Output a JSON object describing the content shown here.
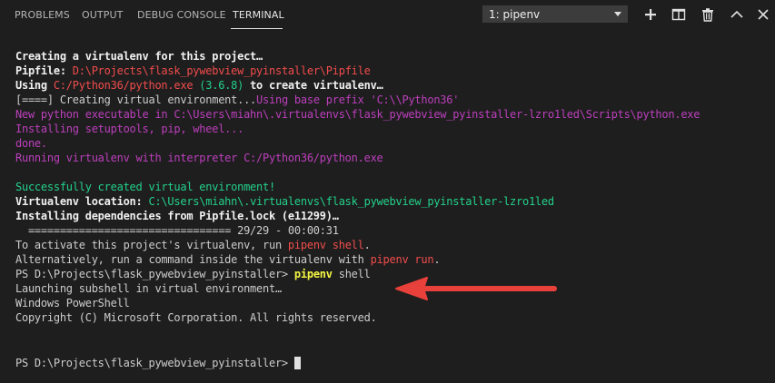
{
  "panel": {
    "tabs": [
      {
        "label": "PROBLEMS"
      },
      {
        "label": "OUTPUT"
      },
      {
        "label": "DEBUG CONSOLE"
      },
      {
        "label": "TERMINAL"
      }
    ],
    "active_tab": "TERMINAL",
    "terminal_select": {
      "value": "1: pipenv"
    },
    "actions": [
      "plus-icon",
      "split-icon",
      "trash-icon",
      "chevron-up-icon",
      "close-icon"
    ]
  },
  "terminal": {
    "line1": "Creating a virtualenv for this project…",
    "line2_a": "Pipfile: ",
    "line2_b": "D:\\Projects\\flask_pywebview_pyinstaller\\Pipfile",
    "line3_a": "Using ",
    "line3_b": "C:/Python36/python.exe",
    "line3_c": " (3.6.8)",
    "line3_d": " to create virtualenv…",
    "line4_a": "[====] Creating virtual environment...",
    "line4_b": "Using base prefix 'C:\\\\Python36'",
    "line5": "New python executable in C:\\Users\\miahn\\.virtualenvs\\flask_pywebview_pyinstaller-lzro1led\\Scripts\\python.exe",
    "line6": "Installing setuptools, pip, wheel...",
    "line7": "done.",
    "line8": "Running virtualenv with interpreter C:/Python36/python.exe",
    "line9": "Successfully created virtual environment!",
    "line10_a": "Virtualenv location: ",
    "line10_b": "C:\\Users\\miahn\\.virtualenvs\\flask_pywebview_pyinstaller-lzro1led",
    "line11": "Installing dependencies from Pipfile.lock (e11299)…",
    "line12": "  ================================ 29/29 - 00:00:31",
    "line13_a": "To activate this project's virtualenv, run ",
    "line13_b": "pipenv shell",
    "line13_c": ".",
    "line14_a": "Alternatively, run a command inside the virtualenv with ",
    "line14_b": "pipenv run",
    "line14_c": ".",
    "line15_a": "PS D:\\Projects\\flask_pywebview_pyinstaller> ",
    "line15_b": "pipenv",
    "line15_c": " shell",
    "line16": "Launching subshell in virtual environment…",
    "line17": "Windows PowerShell",
    "line18": "Copyright (C) Microsoft Corporation. All rights reserved.",
    "line19": "PS D:\\Projects\\flask_pywebview_pyinstaller> "
  },
  "colors": {
    "background": "#1e1e1e",
    "red": "#f14c4c",
    "green": "#23d18b",
    "magenta": "#bc3fbc",
    "yellow": "#f5f543",
    "arrow": "#e8403a"
  }
}
